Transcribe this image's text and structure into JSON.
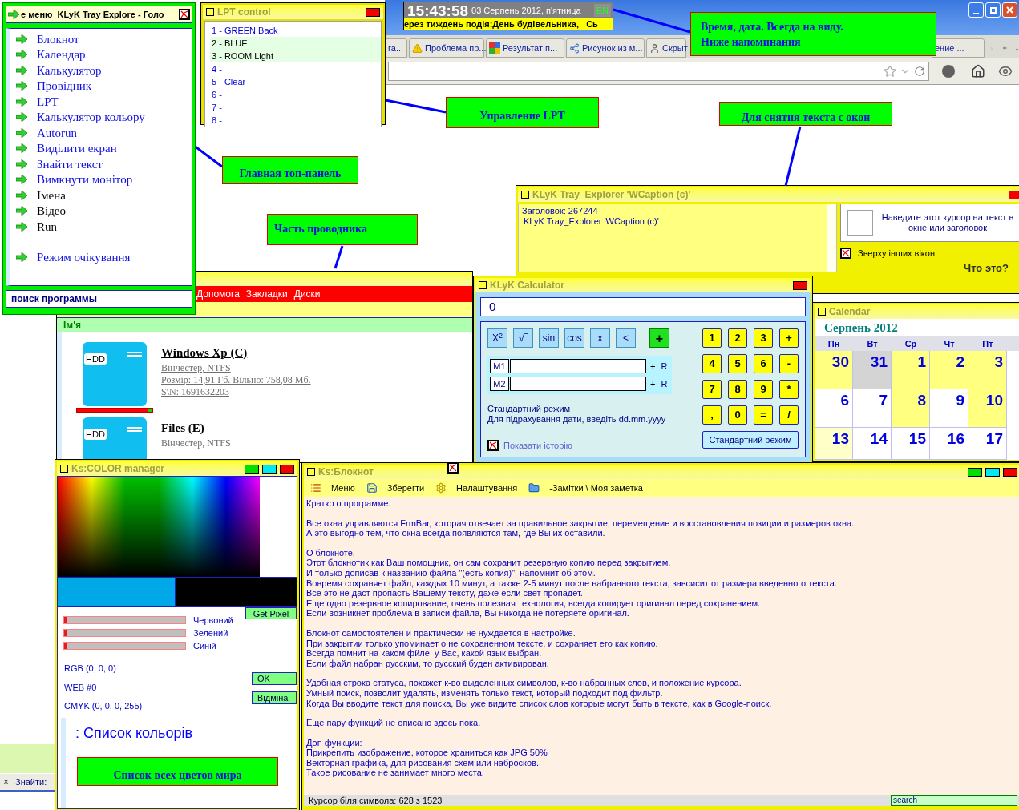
{
  "browser": {
    "tabs": [
      {
        "label": "га..."
      },
      {
        "label": "Проблема пр..."
      },
      {
        "label": "Результат п..."
      },
      {
        "label": "Рисунок из м..."
      },
      {
        "label": "Скрыт"
      },
      {
        "label": "ение ..."
      }
    ]
  },
  "clock": {
    "time": "15:43:58",
    "date": "03 Серпень 2012, п'ятница",
    "lang": "EN",
    "ticker": "ерез тиждень подія:День будівельника,   Сь"
  },
  "main_menu": {
    "title": "е меню  KLyK Tray Explore - Голо",
    "checked": true,
    "items": [
      {
        "label": "Блокнот",
        "kind": "link"
      },
      {
        "label": "Календар",
        "kind": "link"
      },
      {
        "label": "Калькулятор",
        "kind": "link"
      },
      {
        "label": "Провідник",
        "kind": "link"
      },
      {
        "label": "LPT",
        "kind": "link"
      },
      {
        "label": "Калькулятор кольору",
        "kind": "link"
      },
      {
        "label": "Autorun",
        "kind": "link"
      },
      {
        "label": "Виділити екран",
        "kind": "link"
      },
      {
        "label": "Знайти текст",
        "kind": "link"
      },
      {
        "label": "Вимкнути монітор",
        "kind": "link"
      },
      {
        "label": "Імена",
        "kind": "plain"
      },
      {
        "label": "Відео",
        "kind": "underlined"
      },
      {
        "label": "Run",
        "kind": "plain"
      }
    ],
    "standby": {
      "label": "Режим очікування",
      "kind": "link"
    },
    "search": "поиск программы"
  },
  "lpt": {
    "title": "LPT control",
    "items": [
      {
        "label": "1 - GREEN Back",
        "selected": false
      },
      {
        "label": "2 - BLUE",
        "selected": true
      },
      {
        "label": "3 - ROOM Light",
        "selected": true
      },
      {
        "label": "4 -",
        "selected": false
      },
      {
        "label": "5 - Clear",
        "selected": false
      },
      {
        "label": "6 -",
        "selected": false
      },
      {
        "label": "7 -",
        "selected": false
      },
      {
        "label": "8 -",
        "selected": false
      }
    ]
  },
  "callouts": [
    {
      "lines": [
        "Время, дата. Всегда на виду.",
        "Ниже напоминания"
      ]
    },
    {
      "lines": [
        "Управление LPT"
      ]
    },
    {
      "lines": [
        "Для снятия текста с окон"
      ]
    },
    {
      "lines": [
        "Главная топ-панель"
      ]
    },
    {
      "lines": [
        "Часть проводника"
      ]
    },
    {
      "lines": [
        "Список всех цветов мира"
      ]
    }
  ],
  "explorer": {
    "menu": [
      "Допомога",
      "Закладки",
      "Диски"
    ],
    "column": "Ім'я",
    "drives": [
      {
        "badge": "HDD",
        "name": "Windows Xp (C)",
        "selected": true,
        "details": [
          "Вінчестер, NTFS",
          "Розмір: 14,91 Гб. Вільно: 758,08 Мб.",
          "S\\N: 1691632203"
        ],
        "level": 0.95
      },
      {
        "badge": "HDD",
        "name": "Files (E)",
        "selected": false,
        "details": [
          "Вінчестер, NTFS"
        ]
      }
    ]
  },
  "wcaption": {
    "title": "KLyK Tray_Explorer 'WCaption (c)'",
    "lines": [
      "Заголовок: 267244",
      "KLyK Tray_Explorer 'WCaption (c)'"
    ],
    "hint": "Наведите этот курсор на текст в окне или заголовок",
    "on_top": {
      "label": "Зверху інших вікон",
      "checked": true
    },
    "help": "Что это?"
  },
  "calculator": {
    "title": "KLyK Calculator",
    "display": "0",
    "functions": [
      {
        "label": "X$^{2}$",
        "kind": "fn"
      },
      {
        "label": "√‾",
        "kind": "fn"
      },
      {
        "label": "sin",
        "kind": "fn"
      },
      {
        "label": "cos",
        "kind": "fn"
      },
      {
        "label": "x",
        "kind": "fn"
      },
      {
        "label": "<",
        "kind": "fn"
      },
      {
        "label": "+",
        "kind": "accent"
      }
    ],
    "memory": [
      {
        "label": "M1",
        "add": "+",
        "recall": "R"
      },
      {
        "label": "M2",
        "add": "+",
        "recall": "R"
      }
    ],
    "mode": "Стандартний режим",
    "hint": "Для підрахування дати, введіть dd.mm.yyyy",
    "keys": [
      "1",
      "2",
      "3",
      "+",
      "4",
      "5",
      "6",
      "-",
      "7",
      "8",
      "9",
      "*",
      ",",
      "0",
      "=",
      "/"
    ],
    "mode_button": "Стандартний режим",
    "history": {
      "label": "Показати історію",
      "checked": true
    }
  },
  "calendar": {
    "title": "Calendar",
    "month": "Серпень 2012",
    "weekdays": [
      "Пн",
      "Вт",
      "Ср",
      "Чт",
      "Пт"
    ],
    "days": [
      {
        "label": "30",
        "color": "#ffff80"
      },
      {
        "label": "31",
        "color": "#d4d4d4"
      },
      {
        "label": "1",
        "color": "#ffff80"
      },
      {
        "label": "2",
        "color": "#ffff80"
      },
      {
        "label": "3",
        "color": "#ffff80"
      },
      {
        "label": "6",
        "color": "#ffffff"
      },
      {
        "label": "7",
        "color": "#ffffff"
      },
      {
        "label": "8",
        "color": "#ffff80"
      },
      {
        "label": "9",
        "color": "#ffffff"
      },
      {
        "label": "10",
        "color": "#ffff80"
      },
      {
        "label": "13",
        "color": "#ffffc8"
      },
      {
        "label": "14",
        "color": "#ffffff"
      },
      {
        "label": "15",
        "color": "#ffffff"
      },
      {
        "label": "16",
        "color": "#ffffff"
      },
      {
        "label": "17",
        "color": "#ffffff"
      }
    ]
  },
  "color_manager": {
    "title": "Ks:COLOR manager",
    "get_pixel": "Get Pixel",
    "sliders": [
      {
        "label": "Червоний",
        "level": 0
      },
      {
        "label": "Зелений",
        "level": 0
      },
      {
        "label": "Синій",
        "level": 0
      }
    ],
    "rgb": "RGB (0, 0, 0)",
    "web": "WEB #0",
    "cmyk": "CMYK (0, 0, 0, 255)",
    "ok": "OK",
    "cancel": "Відміна",
    "list_link": ": Список кольорів"
  },
  "notepad": {
    "title": "Ks:Блокнот",
    "toolbar": [
      {
        "label": "Меню"
      },
      {
        "label": "Зберегти"
      },
      {
        "label": "Налаштування"
      },
      {
        "label": "-Замітки \\ Моя заметка"
      }
    ],
    "paragraphs": [
      [
        "Кратко о программе."
      ],
      [
        "Все окна управляются FrmBar, которая отвечает за правильное закрытие, перемещение и восстановления позиции и размеров окна.",
        "А это выгодно тем, что окна всегда появляются там, где Вы их оставили."
      ],
      [
        "О блокноте.",
        "Этот блокнотик как Ваш помощник, он сам сохранит резервную копию перед закрытием.",
        "И только дописав к названию файла \"(есть копия)\", напомнит об этом.",
        "Вовремя сохраняет файл, каждых 10 минут, а также 2-5 минут после набранного текста, завсисит от размера введенного текста.",
        "Всё это не даст пропасть Вашему тексту, даже если свет пропадет.",
        "Еще одно резервное копирование, очень полезная технология, всегда копирует оригинал перед сохранением.",
        "Если возникнет проблема в записи файла, Вы никогда не потеряете оригинал."
      ],
      [
        "Блокнот самостоятелен и практически не нуждается в настройке.",
        "При закрытии только упоминает о не сохраненном тексте, и сохраняет его как копию.",
        "Всегда помнит на каком фйле  у Вас, какой язык выбран.",
        "Если файл набран русским, то русский буден активирован."
      ],
      [
        "Удобная строка статуса, покажет к-во выделенных символов, к-во набранных слов, и положение курсора.",
        "Умный поиск, позволит удалять, изменять только текст, который подходит под фильтр.",
        "Когда Вы вводите текст для поиска, Вы уже видите список слов которые могут быть в тексте, как в Google-поиск."
      ],
      [
        "Еще пару функций не описано здесь пока."
      ],
      [
        "Доп функции:",
        "Прикрепить изображение, которое храниться как JPG 50%",
        "Векторная графика, для рисования схем или набросков.",
        "Такое рисование не занимает много места."
      ]
    ],
    "status": "Курсор біля символа: 628 з 1523",
    "search": "search"
  },
  "finder": {
    "close": "×",
    "label": "Знайти:"
  }
}
